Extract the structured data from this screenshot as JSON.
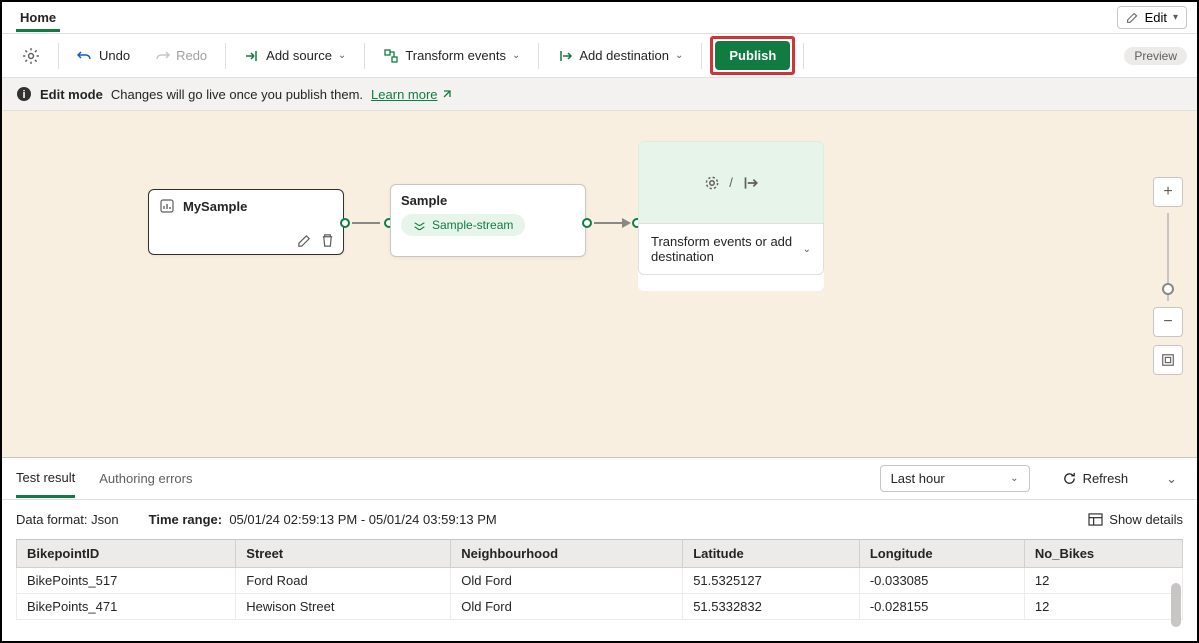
{
  "header": {
    "home_tab": "Home",
    "edit_label": "Edit"
  },
  "toolbar": {
    "undo": "Undo",
    "redo": "Redo",
    "add_source": "Add source",
    "transform_events": "Transform events",
    "add_destination": "Add destination",
    "publish": "Publish",
    "preview": "Preview"
  },
  "info_bar": {
    "mode": "Edit mode",
    "message": "Changes will go live once you publish them.",
    "learn_more": "Learn more"
  },
  "canvas": {
    "source_title": "MySample",
    "sample_title": "Sample",
    "sample_stream": "Sample-stream",
    "dest_text": "Transform events or add destination"
  },
  "bottom": {
    "tabs": {
      "test_result": "Test result",
      "authoring_errors": "Authoring errors"
    },
    "time_select": "Last hour",
    "refresh": "Refresh",
    "data_format_label": "Data format:",
    "data_format_value": "Json",
    "time_range_label": "Time range:",
    "time_range_value": "05/01/24 02:59:13 PM - 05/01/24 03:59:13 PM",
    "show_details": "Show details",
    "columns": [
      "BikepointID",
      "Street",
      "Neighbourhood",
      "Latitude",
      "Longitude",
      "No_Bikes"
    ],
    "rows": [
      {
        "BikepointID": "BikePoints_517",
        "Street": "Ford Road",
        "Neighbourhood": "Old Ford",
        "Latitude": "51.5325127",
        "Longitude": "-0.033085",
        "No_Bikes": "12"
      },
      {
        "BikepointID": "BikePoints_471",
        "Street": "Hewison Street",
        "Neighbourhood": "Old Ford",
        "Latitude": "51.5332832",
        "Longitude": "-0.028155",
        "No_Bikes": "12"
      }
    ]
  }
}
